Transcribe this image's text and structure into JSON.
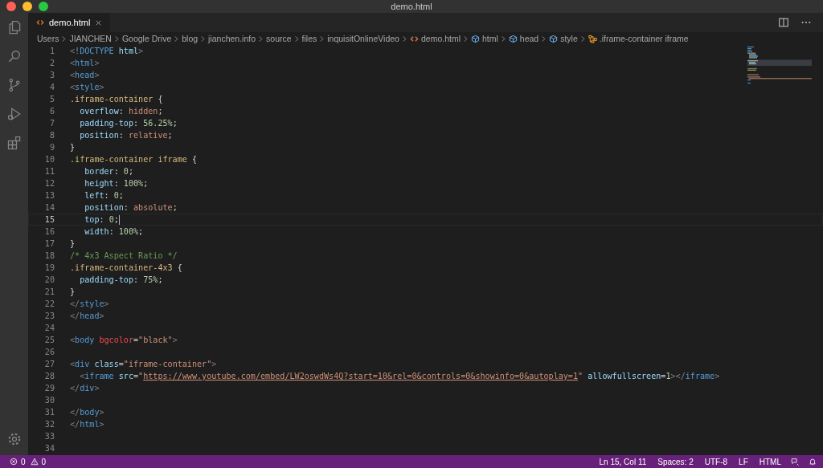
{
  "window": {
    "title": "demo.html"
  },
  "tabs": [
    {
      "label": "demo.html",
      "selected": true
    }
  ],
  "breadcrumb": [
    {
      "text": "Users",
      "kind": "folder"
    },
    {
      "text": "JIANCHEN",
      "kind": "folder"
    },
    {
      "text": "Google Drive",
      "kind": "folder"
    },
    {
      "text": "blog",
      "kind": "folder"
    },
    {
      "text": "jianchen.info",
      "kind": "folder"
    },
    {
      "text": "source",
      "kind": "folder"
    },
    {
      "text": "files",
      "kind": "folder"
    },
    {
      "text": "inquisitOnlineVideo",
      "kind": "folder"
    },
    {
      "text": "demo.html",
      "kind": "file"
    },
    {
      "text": "html",
      "kind": "element"
    },
    {
      "text": "head",
      "kind": "element"
    },
    {
      "text": "style",
      "kind": "element"
    },
    {
      "text": ".iframe-container iframe",
      "kind": "selector"
    }
  ],
  "lines": [
    {
      "number": "1",
      "current": false,
      "tokens": [
        {
          "kind": "punct",
          "text": "<"
        },
        {
          "kind": "tag",
          "text": "!DOCTYPE"
        },
        {
          "kind": "attr",
          "text": " html"
        },
        {
          "kind": "punct",
          "text": ">"
        }
      ]
    },
    {
      "number": "2",
      "current": false,
      "tokens": [
        {
          "kind": "punct",
          "text": "<"
        },
        {
          "kind": "tag",
          "text": "html"
        },
        {
          "kind": "punct",
          "text": ">"
        }
      ]
    },
    {
      "number": "3",
      "current": false,
      "tokens": [
        {
          "kind": "punct",
          "text": "<"
        },
        {
          "kind": "tag",
          "text": "head"
        },
        {
          "kind": "punct",
          "text": ">"
        }
      ]
    },
    {
      "number": "4",
      "current": false,
      "tokens": [
        {
          "kind": "punct",
          "text": "<"
        },
        {
          "kind": "tag",
          "text": "style"
        },
        {
          "kind": "punct",
          "text": ">"
        }
      ]
    },
    {
      "number": "5",
      "current": false,
      "tokens": [
        {
          "kind": "selector",
          "text": ".iframe-container"
        },
        {
          "kind": "plain",
          "text": " {"
        }
      ]
    },
    {
      "number": "6",
      "current": false,
      "tokens": [
        {
          "kind": "prop",
          "text": "  overflow"
        },
        {
          "kind": "plain",
          "text": ": "
        },
        {
          "kind": "value",
          "text": "hidden"
        },
        {
          "kind": "plain",
          "text": ";"
        }
      ]
    },
    {
      "number": "7",
      "current": false,
      "tokens": [
        {
          "kind": "prop",
          "text": "  padding-top"
        },
        {
          "kind": "plain",
          "text": ": "
        },
        {
          "kind": "number",
          "text": "56.25%"
        },
        {
          "kind": "plain",
          "text": ";"
        }
      ]
    },
    {
      "number": "8",
      "current": false,
      "tokens": [
        {
          "kind": "prop",
          "text": "  position"
        },
        {
          "kind": "plain",
          "text": ": "
        },
        {
          "kind": "value",
          "text": "relative"
        },
        {
          "kind": "plain",
          "text": ";"
        }
      ]
    },
    {
      "number": "9",
      "current": false,
      "tokens": [
        {
          "kind": "plain",
          "text": "}"
        }
      ]
    },
    {
      "number": "10",
      "current": false,
      "tokens": [
        {
          "kind": "selector",
          "text": ".iframe-container iframe"
        },
        {
          "kind": "bracket",
          "text": " {"
        }
      ]
    },
    {
      "number": "11",
      "current": false,
      "tokens": [
        {
          "kind": "prop",
          "text": "   border"
        },
        {
          "kind": "plain",
          "text": ": "
        },
        {
          "kind": "number",
          "text": "0"
        },
        {
          "kind": "plain",
          "text": ";"
        }
      ]
    },
    {
      "number": "12",
      "current": false,
      "tokens": [
        {
          "kind": "prop",
          "text": "   height"
        },
        {
          "kind": "plain",
          "text": ": "
        },
        {
          "kind": "number",
          "text": "100%"
        },
        {
          "kind": "plain",
          "text": ";"
        }
      ]
    },
    {
      "number": "13",
      "current": false,
      "tokens": [
        {
          "kind": "prop",
          "text": "   left"
        },
        {
          "kind": "plain",
          "text": ": "
        },
        {
          "kind": "number",
          "text": "0"
        },
        {
          "kind": "plain",
          "text": ";"
        }
      ]
    },
    {
      "number": "14",
      "current": false,
      "tokens": [
        {
          "kind": "prop",
          "text": "   position"
        },
        {
          "kind": "plain",
          "text": ": "
        },
        {
          "kind": "value",
          "text": "absolute"
        },
        {
          "kind": "plain",
          "text": ";"
        }
      ]
    },
    {
      "number": "15",
      "current": true,
      "tokens": [
        {
          "kind": "prop",
          "text": "   top"
        },
        {
          "kind": "plain",
          "text": ": "
        },
        {
          "kind": "number",
          "text": "0"
        },
        {
          "kind": "plain",
          "text": ";"
        }
      ]
    },
    {
      "number": "16",
      "current": false,
      "tokens": [
        {
          "kind": "prop",
          "text": "   width"
        },
        {
          "kind": "plain",
          "text": ": "
        },
        {
          "kind": "number",
          "text": "100%"
        },
        {
          "kind": "plain",
          "text": ";"
        }
      ]
    },
    {
      "number": "17",
      "current": false,
      "tokens": [
        {
          "kind": "bracket",
          "text": "}"
        }
      ]
    },
    {
      "number": "18",
      "current": false,
      "tokens": [
        {
          "kind": "comment",
          "text": "/* 4x3 Aspect Ratio */"
        }
      ]
    },
    {
      "number": "19",
      "current": false,
      "tokens": [
        {
          "kind": "selector",
          "text": ".iframe-container-4x3"
        },
        {
          "kind": "plain",
          "text": " {"
        }
      ]
    },
    {
      "number": "20",
      "current": false,
      "tokens": [
        {
          "kind": "prop",
          "text": "  padding-top"
        },
        {
          "kind": "plain",
          "text": ": "
        },
        {
          "kind": "number",
          "text": "75%"
        },
        {
          "kind": "plain",
          "text": ";"
        }
      ]
    },
    {
      "number": "21",
      "current": false,
      "tokens": [
        {
          "kind": "plain",
          "text": "}"
        }
      ]
    },
    {
      "number": "22",
      "current": false,
      "tokens": [
        {
          "kind": "punct",
          "text": "</"
        },
        {
          "kind": "tag",
          "text": "style"
        },
        {
          "kind": "punct",
          "text": ">"
        }
      ]
    },
    {
      "number": "23",
      "current": false,
      "tokens": [
        {
          "kind": "punct",
          "text": "</"
        },
        {
          "kind": "tag",
          "text": "head"
        },
        {
          "kind": "punct",
          "text": ">"
        }
      ]
    },
    {
      "number": "24",
      "current": false
    },
    {
      "number": "25",
      "current": false,
      "tokens": [
        {
          "kind": "punct",
          "text": "<"
        },
        {
          "kind": "tag",
          "text": "body"
        },
        {
          "kind": "warn",
          "text": " bgcolor"
        },
        {
          "kind": "plain",
          "text": "="
        },
        {
          "kind": "string",
          "text": "\"black\""
        },
        {
          "kind": "punct",
          "text": ">"
        }
      ]
    },
    {
      "number": "26",
      "current": false
    },
    {
      "number": "27",
      "current": false,
      "tokens": [
        {
          "kind": "punct",
          "text": "<"
        },
        {
          "kind": "tag",
          "text": "div"
        },
        {
          "kind": "attr",
          "text": " class"
        },
        {
          "kind": "plain",
          "text": "="
        },
        {
          "kind": "string",
          "text": "\"iframe-container\""
        },
        {
          "kind": "punct",
          "text": ">"
        }
      ]
    },
    {
      "number": "28",
      "current": false,
      "tokens": [
        {
          "kind": "punct",
          "text": "  <"
        },
        {
          "kind": "tag",
          "text": "iframe"
        },
        {
          "kind": "attr",
          "text": " src"
        },
        {
          "kind": "plain",
          "text": "="
        },
        {
          "kind": "string",
          "text": "\""
        },
        {
          "kind": "link",
          "text": "https://www.youtube.com/embed/LW2oswdWs4Q?start=10&rel=0&controls=0&showinfo=0&autoplay=1"
        },
        {
          "kind": "string",
          "text": "\""
        },
        {
          "kind": "attr",
          "text": " allowfullscreen"
        },
        {
          "kind": "plain",
          "text": "="
        },
        {
          "kind": "number",
          "text": "1"
        },
        {
          "kind": "punct",
          "text": "></"
        },
        {
          "kind": "tag",
          "text": "iframe"
        },
        {
          "kind": "punct",
          "text": ">"
        }
      ]
    },
    {
      "number": "29",
      "current": false,
      "tokens": [
        {
          "kind": "punct",
          "text": "</"
        },
        {
          "kind": "tag",
          "text": "div"
        },
        {
          "kind": "punct",
          "text": ">"
        }
      ]
    },
    {
      "number": "30",
      "current": false
    },
    {
      "number": "31",
      "current": false,
      "tokens": [
        {
          "kind": "punct",
          "text": "</"
        },
        {
          "kind": "tag",
          "text": "body"
        },
        {
          "kind": "punct",
          "text": ">"
        }
      ]
    },
    {
      "number": "32",
      "current": false,
      "tokens": [
        {
          "kind": "punct",
          "text": "</"
        },
        {
          "kind": "tag",
          "text": "html"
        },
        {
          "kind": "punct",
          "text": ">"
        }
      ]
    },
    {
      "number": "33",
      "current": false
    },
    {
      "number": "34",
      "current": false
    }
  ],
  "status_bar": {
    "errors": "0",
    "warnings": "0",
    "items": [
      "Ln 15, Col 11",
      "Spaces: 2",
      "UTF-8",
      "LF",
      "HTML"
    ]
  }
}
